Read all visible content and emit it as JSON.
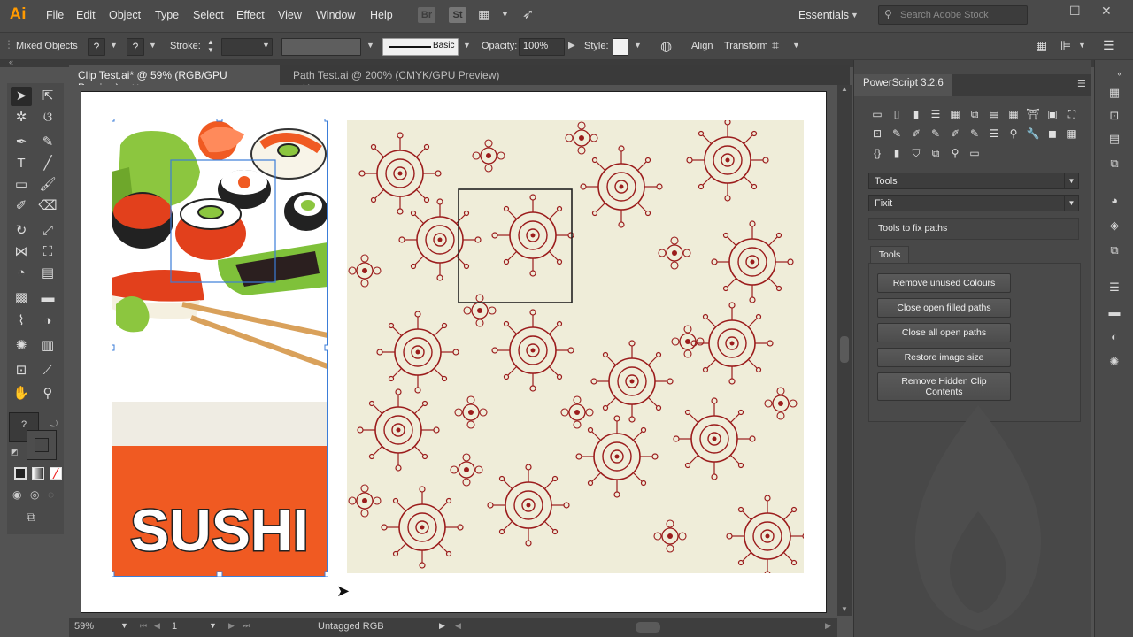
{
  "app": {
    "logo": "Ai"
  },
  "menu": [
    "File",
    "Edit",
    "Object",
    "Type",
    "Select",
    "Effect",
    "View",
    "Window",
    "Help"
  ],
  "menubar_icons": [
    "Br",
    "St"
  ],
  "workspace": "Essentials",
  "search": {
    "placeholder": "Search Adobe Stock"
  },
  "control": {
    "selection": "Mixed Objects",
    "stroke_label": "Stroke:",
    "brush": "Basic",
    "opacity_label": "Opacity:",
    "opacity": "100%",
    "style_label": "Style:",
    "align": "Align",
    "transform": "Transform",
    "q": "?"
  },
  "tabs": [
    {
      "label": "Clip Test.ai* @ 59% (RGB/GPU Preview)",
      "active": true
    },
    {
      "label": "Path Test.ai @ 200% (CMYK/GPU Preview)",
      "active": false
    }
  ],
  "artwork": {
    "title": "SUSHI"
  },
  "status": {
    "zoom": "59%",
    "artboard": "1",
    "profile": "Untagged RGB"
  },
  "panel": {
    "title": "PowerScript 3.2.6",
    "select1": "Tools",
    "select2": "Fixit",
    "description": "Tools to fix paths",
    "inner_tab": "Tools",
    "buttons": [
      "Remove unused Colours",
      "Close open filled paths",
      "Close all open paths",
      "Restore image size",
      "Remove Hidden Clip Contents"
    ]
  },
  "colors": {
    "accent_orange": "#ff9a00",
    "sushi_orange": "#f05a22",
    "pattern_bg": "#efedd9",
    "pattern_ink": "#9b1c1c"
  }
}
